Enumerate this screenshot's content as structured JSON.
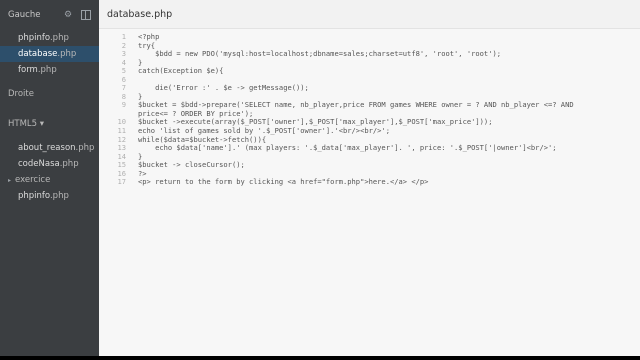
{
  "sidebar": {
    "working_files_title": "Gauche",
    "working_files": [
      {
        "name": "phpinfo",
        "ext": ".php",
        "active": false
      },
      {
        "name": "database",
        "ext": ".php",
        "active": true
      },
      {
        "name": "form",
        "ext": ".php",
        "active": false
      }
    ],
    "right_pane_title": "Droite",
    "project_title": "HTML5 ▾",
    "project_files": [
      {
        "name": "about_reason",
        "ext": ".php"
      },
      {
        "name": "codeNasa",
        "ext": ".php"
      }
    ],
    "folder": {
      "name": "exercice",
      "caret": "▸"
    },
    "project_files_after": [
      {
        "name": "phpinfo",
        "ext": ".php"
      }
    ],
    "icons": {
      "settings": "gear-icon",
      "split": "split-view-icon"
    }
  },
  "editor": {
    "tab_title": "database.php",
    "lines": [
      {
        "n": "1",
        "t": "<?php"
      },
      {
        "n": "2",
        "t": "try{"
      },
      {
        "n": "3",
        "t": "    $bdd = new PDO('mysql:host=localhost;dbname=sales;charset=utf8', 'root', 'root');"
      },
      {
        "n": "4",
        "t": "}"
      },
      {
        "n": "5",
        "t": "catch(Exception $e){"
      },
      {
        "n": "6",
        "t": ""
      },
      {
        "n": "7",
        "t": "    die('Error :' . $e -> getMessage());"
      },
      {
        "n": "8",
        "t": "}"
      },
      {
        "n": "9",
        "t": "$bucket = $bdd->prepare('SELECT name, nb_player,price FROM games WHERE owner = ? AND nb_player <=? AND"
      },
      {
        "n": "",
        "t": "price<= ? ORDER BY price');"
      },
      {
        "n": "10",
        "t": "$bucket ->execute(array($_POST['owner'],$_POST['max_player'],$_POST['max_price']));"
      },
      {
        "n": "11",
        "t": "echo 'list of games sold by '.$_POST['owner'].'<br/><br/>';"
      },
      {
        "n": "12",
        "t": "while($data=$bucket->fetch()){"
      },
      {
        "n": "13",
        "t": "    echo $data['name'].' (max players: '.$_data['max_player']. ', price: '.$_POST['|owner']<br/>';"
      },
      {
        "n": "14",
        "t": "}"
      },
      {
        "n": "15",
        "t": "$bucket -> closeCursor();"
      },
      {
        "n": "16",
        "t": "?>"
      },
      {
        "n": "17",
        "t": "<p> return to the form by clicking <a href=\"form.php\">here.</a> </p>"
      }
    ]
  }
}
